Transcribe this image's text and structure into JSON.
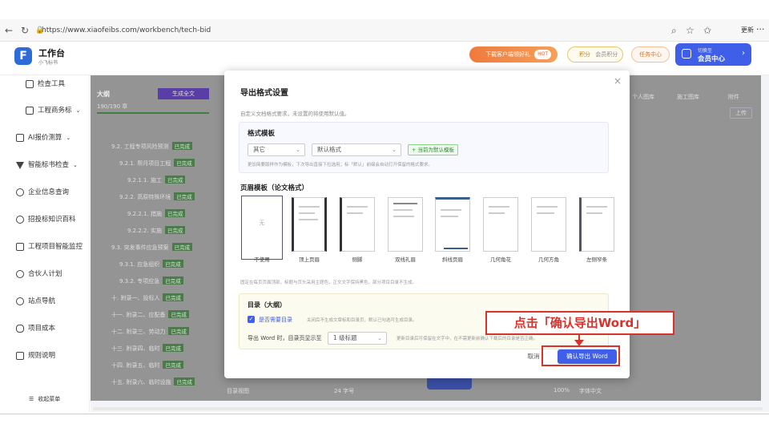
{
  "browser": {
    "url": "https://www.xiaofeibs.com/workbench/tech-bid",
    "update_label": "更新"
  },
  "header": {
    "app_title": "工作台",
    "app_subtitle": "小飞标书",
    "promo_label": "下载客户端领好礼",
    "promo_badge": "HOT",
    "points_label": "积分",
    "points_value": "会员积分",
    "task_label": "任务中心",
    "member_label": "会员中心",
    "member_top": "切换至",
    "accent": "#3f5fe8"
  },
  "sidebar": {
    "items": [
      {
        "label": "检查工具",
        "icon": "inspect-icon"
      },
      {
        "label": "工程商务标",
        "icon": "folder-icon"
      },
      {
        "label": "AI报价测算",
        "icon": "calculator-icon"
      },
      {
        "label": "智能标书检查",
        "icon": "filter-icon"
      },
      {
        "label": "企业信息查询",
        "icon": "search-icon"
      },
      {
        "label": "招投标知识百科",
        "icon": "book-icon"
      },
      {
        "label": "工程项目智能监控",
        "icon": "monitor-icon"
      },
      {
        "label": "合伙人计划",
        "icon": "partner-icon"
      },
      {
        "label": "站点导航",
        "icon": "navigation-icon"
      },
      {
        "label": "项目成本",
        "icon": "database-icon"
      },
      {
        "label": "规则说明",
        "icon": "document-icon"
      }
    ],
    "collapse_label": "收起菜单"
  },
  "background": {
    "outline_title": "大纲",
    "word_count": "190/190 章",
    "generate_btn": "生成全文",
    "rows": [
      {
        "num": "9.2.",
        "text": "工程专项风险预测",
        "tag": "已完成"
      },
      {
        "num": "9.2.1.",
        "text": "帮月项目工程",
        "tag": "已完成"
      },
      {
        "num": "9.2.1.1.",
        "text": "施工",
        "tag": "已完成"
      },
      {
        "num": "9.2.2.",
        "text": "高原特殊环境",
        "tag": "已完成"
      },
      {
        "num": "9.2.2.1.",
        "text": "措施",
        "tag": "已完成"
      },
      {
        "num": "9.2.2.2.",
        "text": "实施",
        "tag": "已完成"
      },
      {
        "num": "9.3.",
        "text": "突发事件应急预案",
        "tag": "已完成"
      },
      {
        "num": "9.3.1.",
        "text": "应急组织",
        "tag": "已完成"
      },
      {
        "num": "9.3.2.",
        "text": "专项应急",
        "tag": "已完成"
      },
      {
        "num": "十.",
        "text": "附录一、投标人",
        "tag": "已完成"
      },
      {
        "num": "十一.",
        "text": "附录二、应配备",
        "tag": "已完成"
      },
      {
        "num": "十二.",
        "text": "附录三、劳动力",
        "tag": "已完成"
      },
      {
        "num": "十三.",
        "text": "附录四、临时",
        "tag": "已完成"
      },
      {
        "num": "十四.",
        "text": "附录五、临时",
        "tag": "已完成"
      },
      {
        "num": "十五.",
        "text": "附录六、临时设施",
        "tag": "已完成"
      }
    ],
    "right_tabs": [
      "个人图库",
      "施工图库",
      "附件"
    ],
    "upload_label": "上传",
    "footer_items": [
      "目录视图",
      "24 字号",
      "100%",
      "字体中文"
    ]
  },
  "modal": {
    "title": "导出格式设置",
    "subtitle": "自定义文档格式要求，未设置的将使用默认值。",
    "format_template_title": "格式模板",
    "format_select_1": "其它",
    "format_select_2": "默认格式",
    "save_template_label": "+ 当前为默认模板",
    "format_hint": "更加简要版样作为模板，下次导出直接下拉选用；标「默认」前缀会自动打开保留的格式要求。",
    "page_template_title": "页眉模板（论文格式）",
    "page_templates": [
      "不使用",
      "顶上页眉",
      "侧脚",
      "双线礼眉",
      "斜线页眉",
      "几何角花",
      "几何方角",
      "左侧窄条"
    ],
    "page_template_placeholder": "无",
    "page_hint": "固定在每页页面顶部，标题与页头采用主题色，正文文字保持黑色，部分项目目录不生成。",
    "toc_title": "目录（大纲）",
    "toc_checkbox_label": "是否需要目录",
    "toc_checkbox_hint": "关闭后不生成文章标和目录页，默认已勾选可生成目录。",
    "toc_level_label": "导出 Word 时，目录页显示至",
    "toc_level_value": "1 级标题",
    "toc_level_hint": "更新目录后可保留在文字中，在不需更新前确认下载后的目录是否正确。",
    "cancel_label": "取消",
    "confirm_label": "确认导出 Word"
  },
  "annotation": {
    "text": "点击「确认导出Word」",
    "color": "#d9312b"
  }
}
